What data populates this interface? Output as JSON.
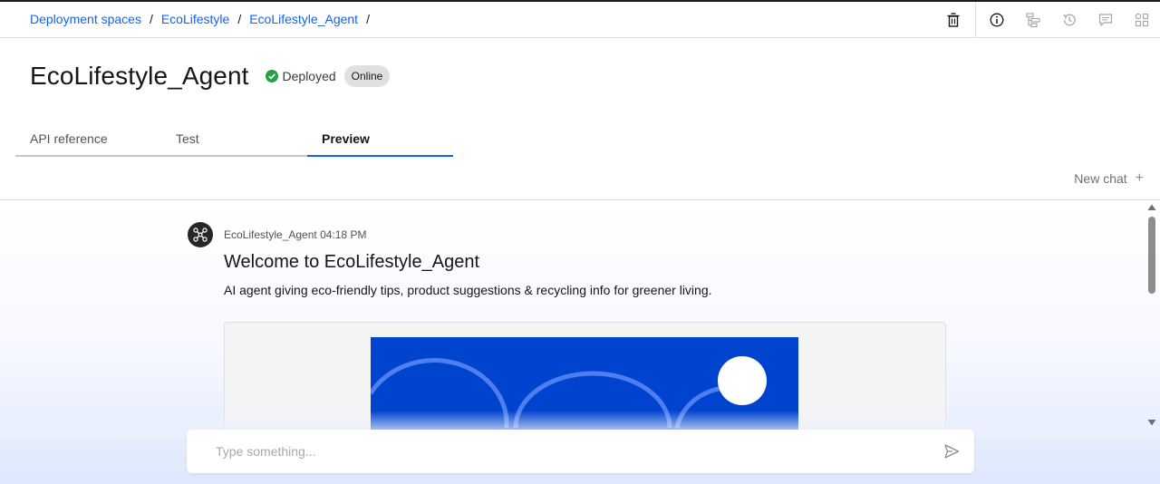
{
  "breadcrumb": {
    "items": [
      "Deployment spaces",
      "EcoLifestyle",
      "EcoLifestyle_Agent"
    ],
    "separator": "/"
  },
  "toolbar": {
    "icons": [
      "trash-icon",
      "info-icon",
      "tree-icon",
      "history-icon",
      "chat-icon",
      "apps-icon"
    ]
  },
  "page": {
    "title": "EcoLifestyle_Agent",
    "status": "Deployed",
    "tag": "Online"
  },
  "tabs": [
    {
      "label": "API reference",
      "active": false
    },
    {
      "label": "Test",
      "active": false
    },
    {
      "label": "Preview",
      "active": true
    }
  ],
  "new_chat": {
    "label": "New chat",
    "icon": "+"
  },
  "message": {
    "sender": "EcoLifestyle_Agent",
    "time": "04:18 PM",
    "welcome": "Welcome to EcoLifestyle_Agent",
    "description": "AI agent giving eco-friendly tips, product suggestions & recycling info for greener living."
  },
  "chat_input": {
    "placeholder": "Type something..."
  },
  "colors": {
    "link": "#0f62fe",
    "success": "#24a148",
    "banner": "#0043ce",
    "tab_active": "#0f62fe"
  }
}
